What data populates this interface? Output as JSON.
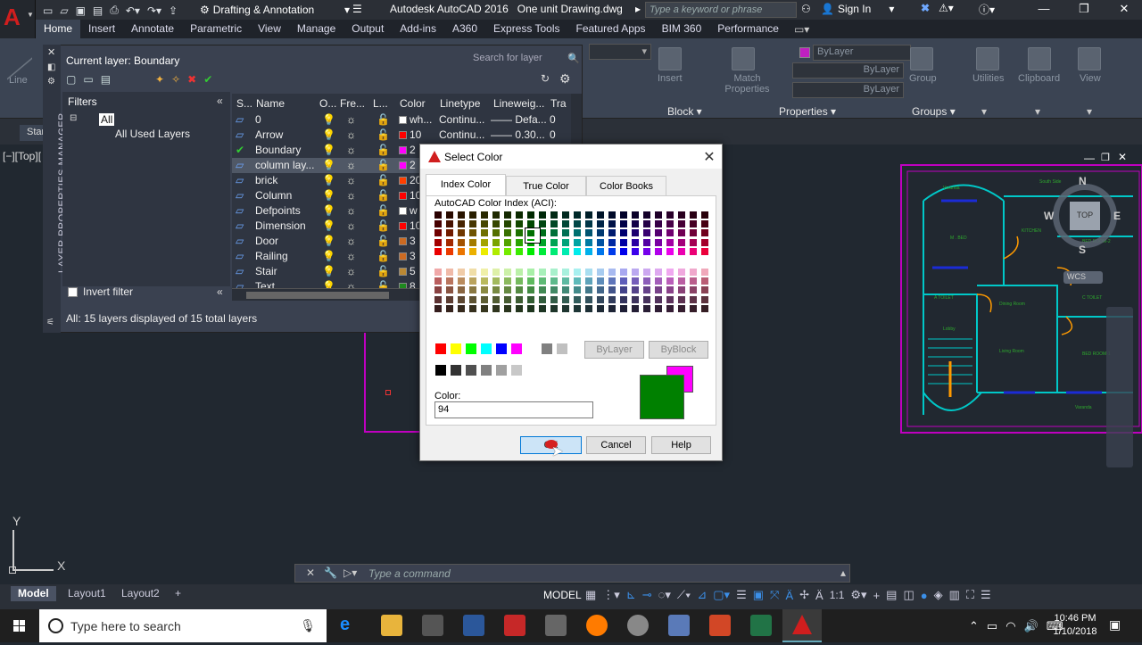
{
  "title_bar": {
    "workspace": "Drafting & Annotation",
    "app_title": "Autodesk AutoCAD 2016",
    "file_name": "One unit Drawing.dwg",
    "search_placeholder": "Type a keyword or phrase",
    "sign_in": "Sign In"
  },
  "ribbon": {
    "tabs": [
      "Home",
      "Insert",
      "Annotate",
      "Parametric",
      "View",
      "Manage",
      "Output",
      "Add-ins",
      "A360",
      "Express Tools",
      "Featured Apps",
      "BIM 360",
      "Performance"
    ],
    "active_tab": "Home",
    "line_label": "Line",
    "insert_label": "Insert",
    "match_properties_label": "Match Properties",
    "group_label": "Group",
    "utilities_label": "Utilities",
    "clipboard_label": "Clipboard",
    "view_label": "View",
    "block_panel": "Block",
    "properties_panel": "Properties",
    "groups_panel": "Groups",
    "bylayer_color": "ByLayer",
    "bylayer_linetype": "ByLayer",
    "bylayer_lineweight": "ByLayer"
  },
  "file_tab": {
    "start": "Start"
  },
  "viewport_label": "[−][Top][",
  "layer_manager": {
    "vertical_title": "LAYER PROPERTIES MANAGER",
    "current_layer": "Current layer: Boundary",
    "search_placeholder": "Search for layer",
    "filters_title": "Filters",
    "tree_all": "All",
    "tree_used": "All Used Layers",
    "invert_filter": "Invert filter",
    "status": "All: 15 layers displayed of 15 total layers",
    "columns": [
      "S...",
      "Name",
      "O...",
      "Fre...",
      "L...",
      "Color",
      "Linetype",
      "Lineweig...",
      "Tra"
    ],
    "rows": [
      {
        "name": "0",
        "color_text": "wh...",
        "color": "#ffffff",
        "linetype": "Continu...",
        "lineweight": "—— Defa...",
        "trans": "0"
      },
      {
        "name": "Arrow",
        "color_text": "10",
        "color": "#ff0000",
        "linetype": "Continu...",
        "lineweight": "—— 0.30...",
        "trans": "0"
      },
      {
        "name": "Boundary",
        "color_text": "2",
        "color": "#ff00ff",
        "linetype": "",
        "lineweight": "",
        "trans": ""
      },
      {
        "name": "column lay...",
        "color_text": "2",
        "color": "#ff00ff",
        "linetype": "",
        "lineweight": "",
        "trans": ""
      },
      {
        "name": "brick",
        "color_text": "20",
        "color": "#ff3f00",
        "linetype": "",
        "lineweight": "",
        "trans": ""
      },
      {
        "name": "Column",
        "color_text": "10",
        "color": "#ff0000",
        "linetype": "",
        "lineweight": "",
        "trans": ""
      },
      {
        "name": "Defpoints",
        "color_text": "w",
        "color": "#ffffff",
        "linetype": "",
        "lineweight": "",
        "trans": ""
      },
      {
        "name": "Dimension",
        "color_text": "10",
        "color": "#ff0000",
        "linetype": "",
        "lineweight": "",
        "trans": ""
      },
      {
        "name": "Door",
        "color_text": "3",
        "color": "#cc6a22",
        "linetype": "",
        "lineweight": "",
        "trans": ""
      },
      {
        "name": "Railing",
        "color_text": "3",
        "color": "#cc6a22",
        "linetype": "",
        "lineweight": "",
        "trans": ""
      },
      {
        "name": "Stair",
        "color_text": "5",
        "color": "#bb8833",
        "linetype": "",
        "lineweight": "",
        "trans": ""
      },
      {
        "name": "Text",
        "color_text": "8",
        "color": "#1e8a1e",
        "linetype": "",
        "lineweight": "",
        "trans": ""
      }
    ]
  },
  "select_color": {
    "title": "Select Color",
    "tabs": [
      "Index Color",
      "True Color",
      "Color Books"
    ],
    "aci_label": "AutoCAD Color Index (ACI):",
    "bylayer": "ByLayer",
    "byblock": "ByBlock",
    "color_label": "Color:",
    "color_value": "94",
    "ok": "OK",
    "cancel": "Cancel",
    "help": "Help",
    "new_color": "#008000",
    "old_color": "#ff00ff"
  },
  "compass": {
    "n": "N",
    "s": "S",
    "e": "E",
    "w": "W",
    "top": "TOP",
    "wcs": "WCS"
  },
  "command_placeholder": "Type a command",
  "status_bar": {
    "layouts": [
      "Model",
      "Layout1",
      "Layout2"
    ],
    "model": "MODEL",
    "scale": "1:1"
  },
  "taskbar": {
    "search": "Type here to search",
    "time": "10:46 PM",
    "date": "1/10/2018"
  },
  "ucs": {
    "y": "Y",
    "x": "X"
  },
  "plan_labels": [
    "Varanda",
    "South Side",
    "M . BED",
    "KITCHEN",
    "BED ROOM-2",
    "A TOILET",
    "Dining Room",
    "C TOILET",
    "Lobby",
    "Living Room",
    "BED ROOM-1",
    "Varanda"
  ]
}
